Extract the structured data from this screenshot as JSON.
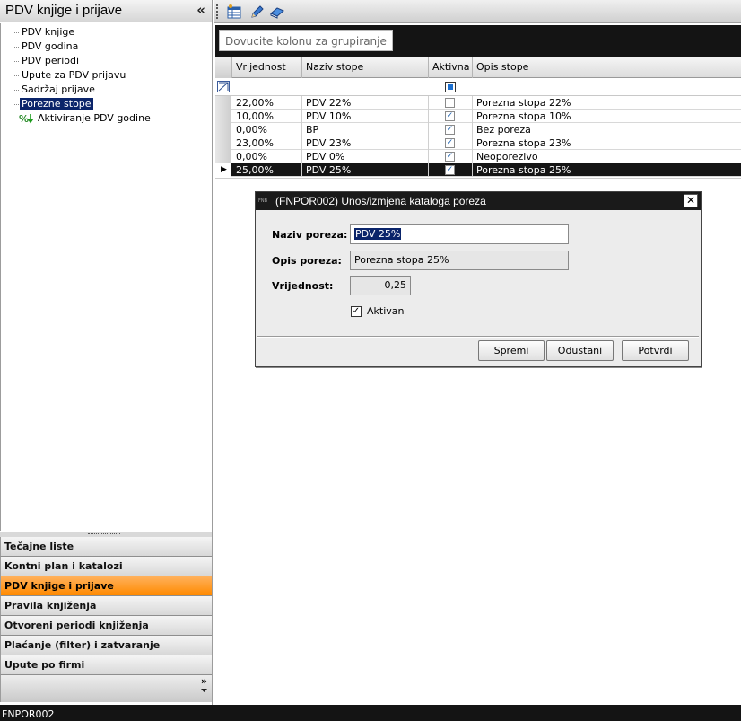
{
  "left_panel": {
    "title": "PDV knjige i prijave",
    "collapse_glyph": "«",
    "tree": [
      {
        "label": "PDV knjige",
        "selected": false
      },
      {
        "label": "PDV godina",
        "selected": false
      },
      {
        "label": "PDV periodi",
        "selected": false
      },
      {
        "label": "Upute za PDV prijavu",
        "selected": false
      },
      {
        "label": "Sadržaj prijave",
        "selected": false
      },
      {
        "label": "Porezne stope",
        "selected": true
      },
      {
        "label": "Aktiviranje PDV godine",
        "selected": false,
        "icon": "percent-icon"
      }
    ],
    "nav": [
      {
        "label": "Tečajne liste",
        "active": false
      },
      {
        "label": "Kontni plan i katalozi",
        "active": false
      },
      {
        "label": "PDV knjige i prijave",
        "active": true
      },
      {
        "label": "Pravila knjiženja",
        "active": false
      },
      {
        "label": "Otvoreni periodi knjiženja",
        "active": false
      },
      {
        "label": "Plaćanje (filter) i zatvaranje",
        "active": false
      },
      {
        "label": "Upute po firmi",
        "active": false
      }
    ],
    "nav_more_glyph": "»"
  },
  "toolbar": {
    "icons": [
      "grid-settings-icon",
      "edit-pencil-icon",
      "eraser-icon"
    ]
  },
  "grid": {
    "group_hint": "Dovucite kolonu za grupiranje",
    "columns": [
      "Vrijednost",
      "Naziv stope",
      "Aktivna",
      "Opis stope"
    ],
    "rows": [
      {
        "vrijednost": "22,00%",
        "naziv": "PDV 22%",
        "aktivna": false,
        "opis": "Porezna stopa 22%"
      },
      {
        "vrijednost": "10,00%",
        "naziv": "PDV 10%",
        "aktivna": true,
        "opis": "Porezna stopa 10%"
      },
      {
        "vrijednost": "0,00%",
        "naziv": "BP",
        "aktivna": true,
        "opis": "Bez poreza"
      },
      {
        "vrijednost": "23,00%",
        "naziv": "PDV 23%",
        "aktivna": true,
        "opis": "Porezna stopa 23%"
      },
      {
        "vrijednost": "0,00%",
        "naziv": "PDV 0%",
        "aktivna": true,
        "opis": "Neoporezivo"
      },
      {
        "vrijednost": "25,00%",
        "naziv": "PDV 25%",
        "aktivna": true,
        "opis": "Porezna stopa 25%",
        "selected": true
      }
    ]
  },
  "dialog": {
    "title": "(FNPOR002) Unos/izmjena kataloga poreza",
    "logo_text": "FNB",
    "close_glyph": "✕",
    "naziv_label": "Naziv poreza:",
    "naziv_value": "PDV 25%",
    "opis_label": "Opis poreza:",
    "opis_value": "Porezna stopa 25%",
    "vrijednost_label": "Vrijednost:",
    "vrijednost_value": "0,25",
    "aktivan_label": "Aktivan",
    "aktivan_checked": true,
    "buttons": {
      "spremi": "Spremi",
      "odustani": "Odustani",
      "potvrdi": "Potvrdi"
    }
  },
  "status_bar": {
    "form_code": "FNPOR002"
  }
}
